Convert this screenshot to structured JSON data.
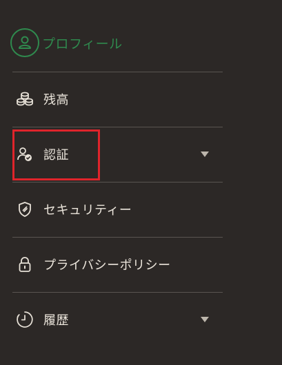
{
  "profile": {
    "label": "プロフィール",
    "accent_color": "#2f8a4e",
    "icon": "user-circle-icon"
  },
  "menu": {
    "items": [
      {
        "label": "残高",
        "icon": "coins-stack-icon",
        "has_chevron": false
      },
      {
        "label": "認証",
        "icon": "user-verified-icon",
        "has_chevron": true,
        "highlighted": true
      },
      {
        "label": "セキュリティー",
        "icon": "shield-icon",
        "has_chevron": false
      },
      {
        "label": "プライバシーポリシー",
        "icon": "lock-icon",
        "has_chevron": false
      },
      {
        "label": "履歴",
        "icon": "history-clock-icon",
        "has_chevron": true
      }
    ]
  },
  "highlight_color": "#e0242b"
}
